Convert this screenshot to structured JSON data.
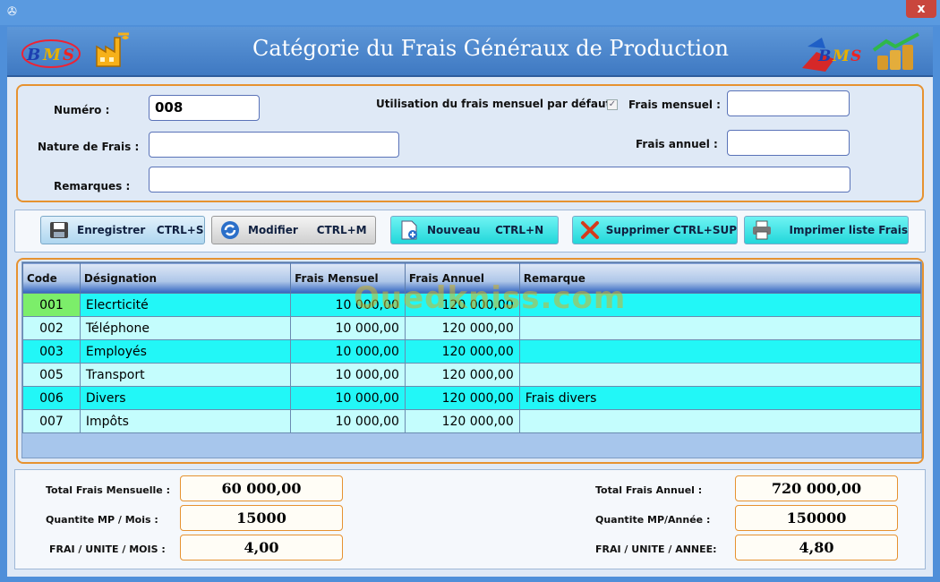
{
  "window": {
    "close_label": "x"
  },
  "banner": {
    "title": "Catégorie du Frais Généraux de Production",
    "logo_text": "BMS"
  },
  "form": {
    "numero_label": "Numéro :",
    "numero_value": "008",
    "nature_label": "Nature de  Frais :",
    "nature_value": "",
    "remarques_label": "Remarques :",
    "remarques_value": "",
    "default_label": "Utilisation du frais mensuel par défaut",
    "default_checked": true,
    "mensuel_label": "Frais mensuel :",
    "mensuel_value": "",
    "annuel_label": "Frais annuel :",
    "annuel_value": ""
  },
  "toolbar": {
    "enregistrer": "Enregistrer   CTRL+S",
    "modifier": "Modifier     CTRL+M",
    "nouveau": "Nouveau    CTRL+N",
    "supprimer": "Supprimer CTRL+SUP",
    "imprimer": "Imprimer liste Frais"
  },
  "grid": {
    "columns": [
      "Code",
      "Désignation",
      "Frais Mensuel",
      "Frais Annuel",
      "Remarque"
    ],
    "rows": [
      {
        "code": "001",
        "designation": "Elecrticité",
        "mensuel": "10 000,00",
        "annuel": "120 000,00",
        "remarque": ""
      },
      {
        "code": "002",
        "designation": "Téléphone",
        "mensuel": "10 000,00",
        "annuel": "120 000,00",
        "remarque": ""
      },
      {
        "code": "003",
        "designation": "Employés",
        "mensuel": "10 000,00",
        "annuel": "120 000,00",
        "remarque": ""
      },
      {
        "code": "005",
        "designation": "Transport",
        "mensuel": "10 000,00",
        "annuel": "120 000,00",
        "remarque": ""
      },
      {
        "code": "006",
        "designation": "Divers",
        "mensuel": "10 000,00",
        "annuel": "120 000,00",
        "remarque": "Frais divers"
      },
      {
        "code": "007",
        "designation": "Impôts",
        "mensuel": "10 000,00",
        "annuel": "120 000,00",
        "remarque": ""
      }
    ],
    "watermark": "Ouedkniss.com"
  },
  "totals": {
    "total_mensuel_label": "Total Frais Mensuelle :",
    "total_mensuel_value": "60 000,00",
    "qte_mois_label": "Quantite  MP  / Mois :",
    "qte_mois_value": "15000",
    "unite_mois_label": "FRAI / UNITE / MOIS :",
    "unite_mois_value": "4,00",
    "total_annuel_label": "Total  Frais  Annuel :",
    "total_annuel_value": "720 000,00",
    "qte_annee_label": "Quantite  MP/Année :",
    "qte_annee_value": "150000",
    "unite_annee_label": "FRAI / UNITE / ANNEE:",
    "unite_annee_value": "4,80"
  },
  "colors": {
    "accent_orange": "#e69230",
    "row_cyan": "#22f7f7",
    "row_light": "#c4fdfd",
    "selected_cell": "#7cee6a",
    "banner_blue": "#4f88cf"
  }
}
